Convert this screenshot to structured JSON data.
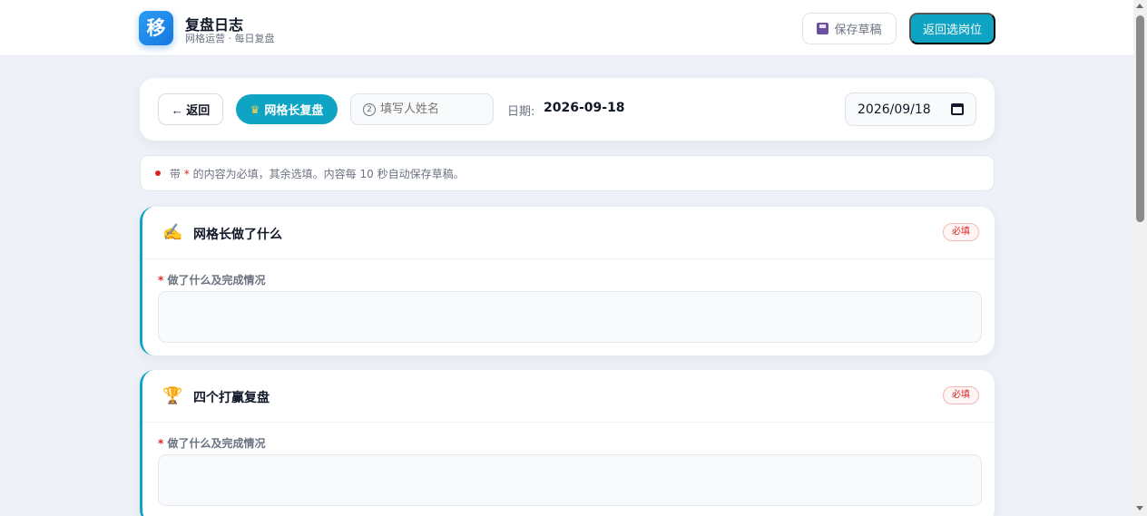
{
  "header": {
    "logo_char": "移",
    "title": "复盘日志",
    "subtitle": "网格运营 · 每日复盘",
    "save_draft_label": "保存草稿",
    "return_label": "返回选岗位"
  },
  "toolbar": {
    "back_label": "← 返回",
    "role_label": "网格长复盘",
    "name_placeholder": "填写人姓名",
    "date_label": "日期:",
    "date_value": "2026-09-18",
    "date_picker_value": "2026/09/18"
  },
  "notice": {
    "prefix": "带",
    "star": "*",
    "text": "的内容为必填，其余选填。内容每 10 秒自动保存草稿。"
  },
  "sections": [
    {
      "icon": "✍️",
      "title": "网格长做了什么",
      "badge": "必填",
      "field_star": "*",
      "field_label": "做了什么及完成情况"
    },
    {
      "icon": "🏆",
      "title": "四个打赢复盘",
      "badge": "必填",
      "field_star": "*",
      "field_label": "做了什么及完成情况"
    }
  ],
  "colors": {
    "accent": "#10a4c4",
    "logo": "#1677e0",
    "required": "#dc2626",
    "background": "#eef2f8"
  },
  "icons": [
    "floppy-disk-icon",
    "crown-icon",
    "name-icon",
    "calendar-icon",
    "writing-hand-icon",
    "trophy-icon"
  ]
}
